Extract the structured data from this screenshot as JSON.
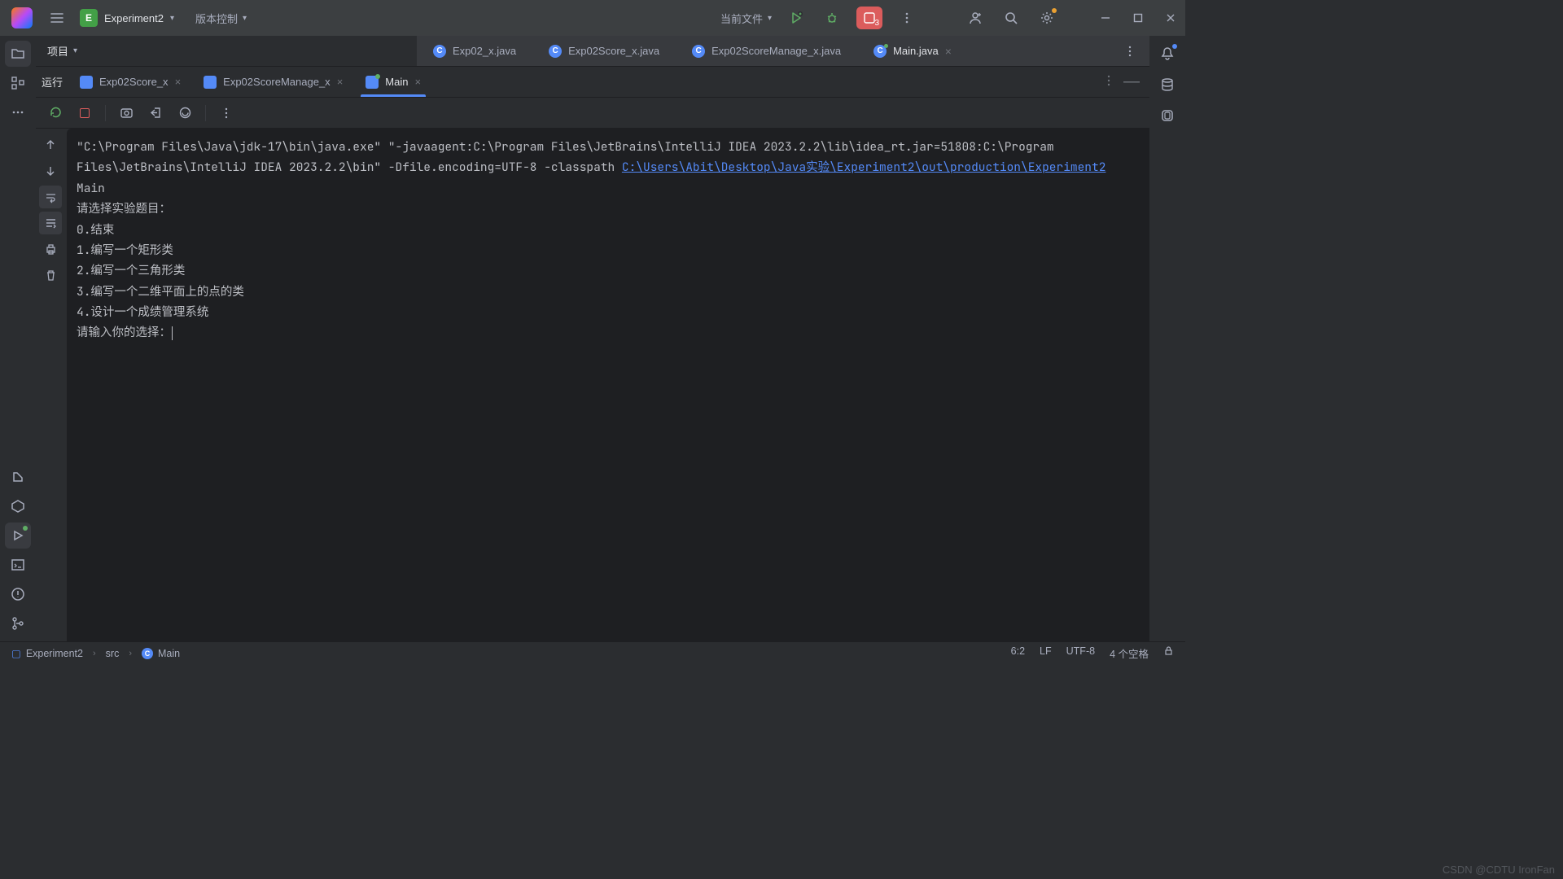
{
  "titlebar": {
    "project_badge": "E",
    "project_name": "Experiment2",
    "vcs_menu": "版本控制",
    "current_file": "当前文件"
  },
  "notif_count": "3",
  "left_tools": [
    "folder",
    "structure",
    "more",
    "build",
    "services",
    "run",
    "terminal",
    "problems",
    "git"
  ],
  "project_panel_title": "项目",
  "editor_tabs": [
    {
      "label": "Exp02_x.java",
      "active": false,
      "dot": false,
      "close": false
    },
    {
      "label": "Exp02Score_x.java",
      "active": false,
      "dot": false,
      "close": false
    },
    {
      "label": "Exp02ScoreManage_x.java",
      "active": false,
      "dot": false,
      "close": false
    },
    {
      "label": "Main.java",
      "active": true,
      "dot": true,
      "close": true
    }
  ],
  "run_label": "运行",
  "run_tabs": [
    {
      "label": "Exp02Score_x",
      "active": false,
      "close": true,
      "dot": false
    },
    {
      "label": "Exp02ScoreManage_x",
      "active": false,
      "close": true,
      "dot": false
    },
    {
      "label": "Main",
      "active": true,
      "close": true,
      "dot": true
    }
  ],
  "console": {
    "cmd_line1": "\"C:\\Program Files\\Java\\jdk-17\\bin\\java.exe\" \"-javaagent:C:\\Program Files\\JetBrains\\IntelliJ IDEA 2023.2.2\\lib\\idea_rt.jar=51808:C:\\Program Files\\JetBrains\\IntelliJ IDEA 2023.2.2\\bin\" -Dfile.encoding=UTF-8 -classpath ",
    "classpath_link": "C:\\Users\\Abit\\Desktop\\Java实验\\Experiment2\\out\\production\\Experiment2",
    "main_token": " Main",
    "lines": [
      "请选择实验题目：",
      "0.结束",
      "1.编写一个矩形类",
      "2.编写一个三角形类",
      "3.编写一个二维平面上的点的类",
      "4.设计一个成绩管理系统",
      "请输入你的选择："
    ]
  },
  "breadcrumb": {
    "seg1": "Experiment2",
    "seg2": "src",
    "seg3": "Main"
  },
  "status_right": {
    "pos": "6:2",
    "lf": "LF",
    "enc": "UTF-8",
    "indent": "4 个空格"
  },
  "watermark": "CSDN @CDTU IronFan"
}
